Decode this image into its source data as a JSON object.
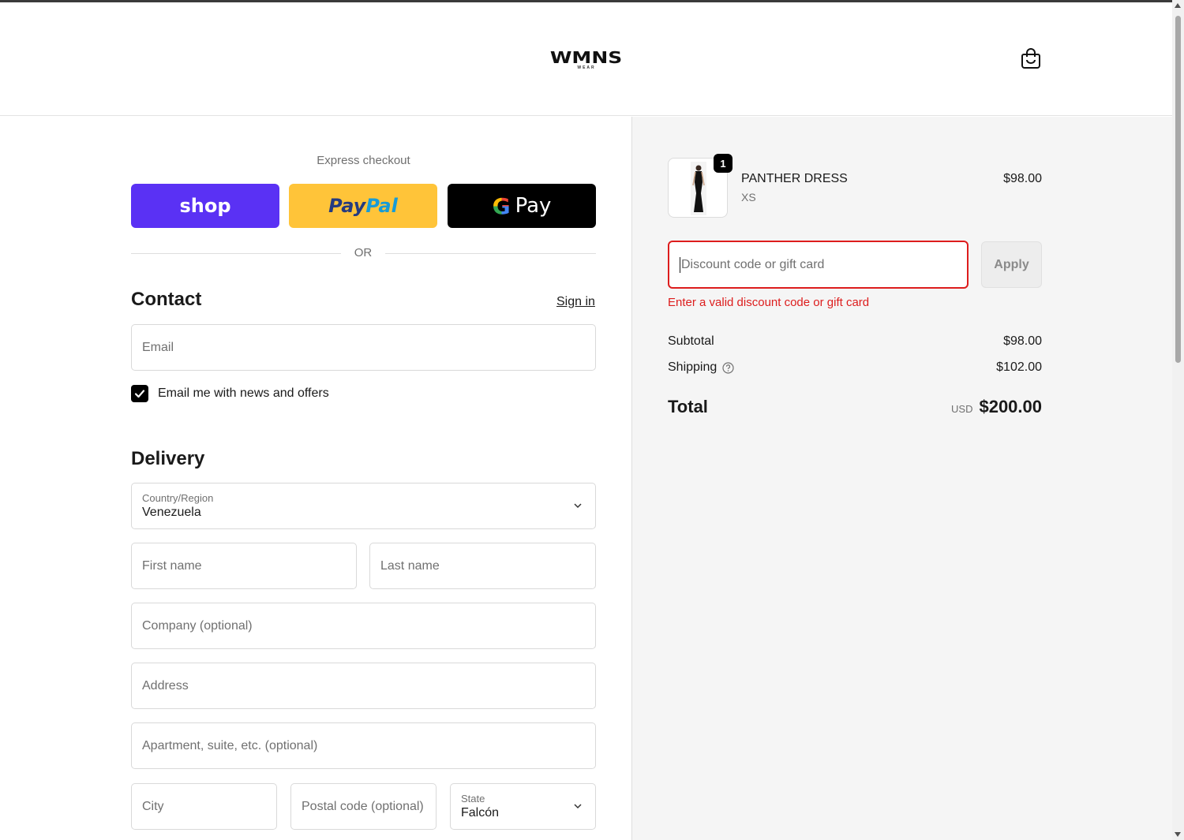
{
  "header": {
    "logo_text": "WMNS",
    "logo_subtext": "WEAR",
    "cart_icon": "shopping-bag-icon"
  },
  "express": {
    "title": "Express checkout",
    "shop_label": "shop",
    "paypal_pay": "Pay",
    "paypal_pal": "Pal",
    "gpay_g": "G",
    "gpay_label": "Pay",
    "or_label": "OR"
  },
  "contact": {
    "heading": "Contact",
    "sign_in": "Sign in",
    "email_placeholder": "Email",
    "newsletter_checked": true,
    "newsletter_label": "Email me with news and offers"
  },
  "delivery": {
    "heading": "Delivery",
    "country_label": "Country/Region",
    "country_value": "Venezuela",
    "first_name": "First name",
    "last_name": "Last name",
    "company": "Company (optional)",
    "address": "Address",
    "apartment": "Apartment, suite, etc. (optional)",
    "city": "City",
    "postal": "Postal code (optional)",
    "state_label": "State",
    "state_value": "Falcón"
  },
  "order": {
    "item": {
      "quantity": "1",
      "name": "PANTHER DRESS",
      "variant": "XS",
      "price": "$98.00"
    },
    "discount_placeholder": "Discount code or gift card",
    "apply_label": "Apply",
    "error_text": "Enter a valid discount code or gift card",
    "subtotal_label": "Subtotal",
    "subtotal_value": "$98.00",
    "shipping_label": "Shipping",
    "shipping_value": "$102.00",
    "total_label": "Total",
    "currency": "USD",
    "total_value": "$200.00"
  },
  "colors": {
    "shop_purple": "#5a31f4",
    "paypal_yellow": "#ffc439",
    "error_red": "#dd1d1d"
  }
}
